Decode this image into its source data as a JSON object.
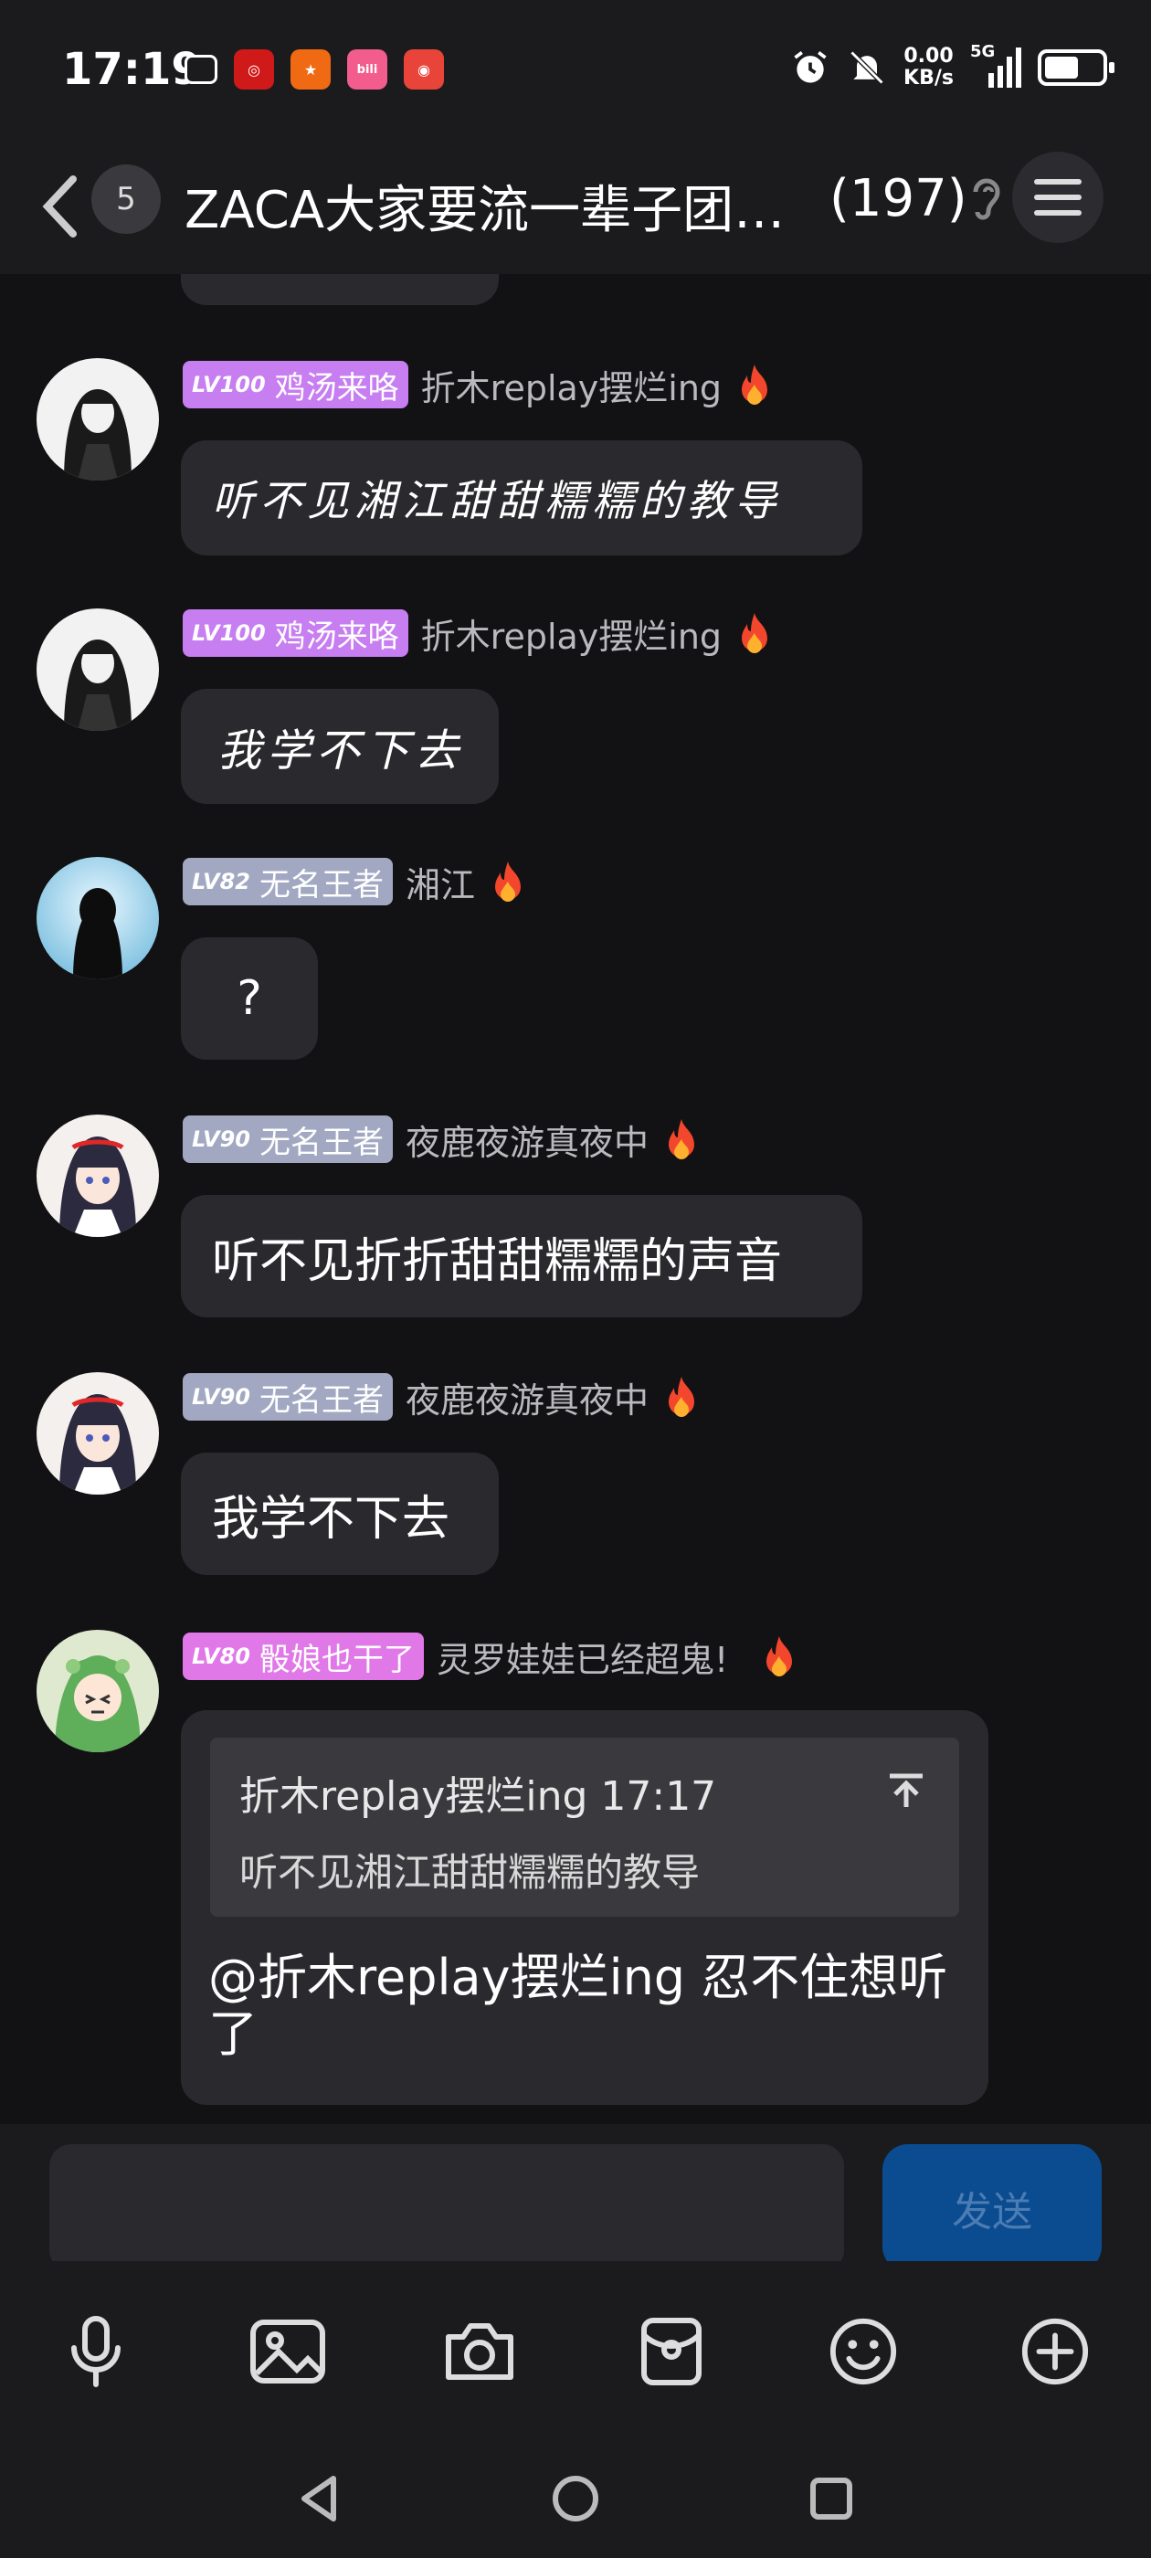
{
  "status_bar": {
    "time": "17:19",
    "net_speed_value": "0.00",
    "net_speed_unit": "KB/s",
    "network_type": "5G",
    "battery_level": 0.6,
    "app_icons": [
      {
        "name": "tv-app",
        "color": "#1b1b1e",
        "glyph": "◘"
      },
      {
        "name": "bank-app",
        "color": "#d01a1a",
        "glyph": "◎"
      },
      {
        "name": "shopping-app",
        "color": "#f06a13",
        "glyph": "★"
      },
      {
        "name": "bilibili-app",
        "color": "#f25d8e",
        "glyph": "bili"
      },
      {
        "name": "game-app",
        "color": "#e8443a",
        "glyph": "◉"
      }
    ]
  },
  "header": {
    "unread_count": "5",
    "title": "ZACA大家要流一辈子团…",
    "member_count": "(197)"
  },
  "messages": [
    {
      "level": "LV100",
      "title": "鸡汤来咯",
      "badge_color": "#c77ef0",
      "sender": "折木replay摆烂ing",
      "text": "听不见湘江甜甜糯糯的教导",
      "avatar": "dark-girl"
    },
    {
      "level": "LV100",
      "title": "鸡汤来咯",
      "badge_color": "#c77ef0",
      "sender": "折木replay摆烂ing",
      "text": "我学不下去",
      "avatar": "dark-girl"
    },
    {
      "level": "LV82",
      "title": "无名王者",
      "badge_color": "#a2a8c2",
      "sender": "湘江",
      "text": "?",
      "avatar": "silhouette"
    },
    {
      "level": "LV90",
      "title": "无名王者",
      "badge_color": "#a2a8c2",
      "sender": "夜鹿夜游真夜中",
      "text": "听不见折折甜甜糯糯的声音",
      "avatar": "anime-girl"
    },
    {
      "level": "LV90",
      "title": "无名王者",
      "badge_color": "#a2a8c2",
      "sender": "夜鹿夜游真夜中",
      "text": "我学不下去",
      "avatar": "anime-girl"
    },
    {
      "level": "LV80",
      "title": "骰娘也干了",
      "badge_color": "#e078e8",
      "sender": "灵罗娃娃已经超鬼!",
      "avatar": "green-girl",
      "quote": {
        "author_time": "折木replay摆烂ing 17:17",
        "text": "听不见湘江甜甜糯糯的教导"
      },
      "text": "@折木replay摆烂ing 忍不住想听了"
    }
  ],
  "input": {
    "placeholder": "",
    "send_label": "发送"
  }
}
